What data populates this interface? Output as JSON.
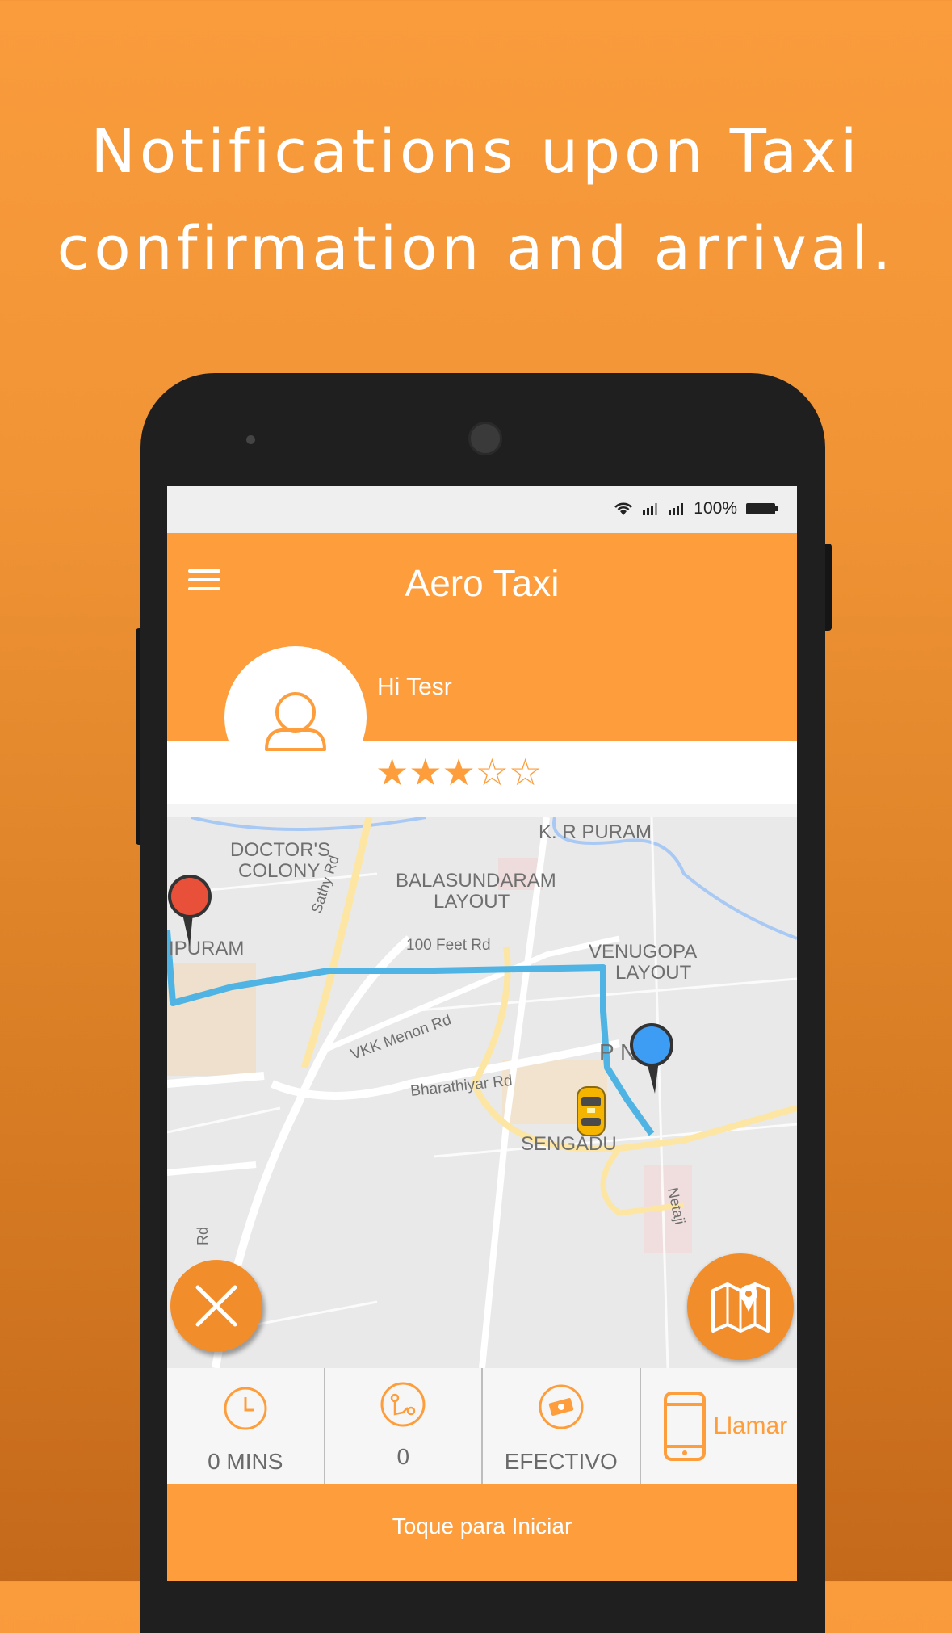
{
  "headline": {
    "line1": "Notifications upon Taxi",
    "line2": "confirmation and arrival."
  },
  "status_bar": {
    "battery": "100%",
    "icons": [
      "wifi-icon",
      "signal-icon",
      "signal-icon",
      "battery-icon"
    ]
  },
  "app_bar": {
    "title": "Aero Taxi",
    "menu_icon": "hamburger-menu-icon"
  },
  "driver": {
    "greeting": "Hi Tesr",
    "avatar_icon": "user-avatar-icon",
    "rating": 3,
    "rating_max": 5
  },
  "map": {
    "labels": {
      "kr_puram": "K. R PURAM",
      "doctors_colony_1": "DOCTOR'S",
      "doctors_colony_2": "COLONY",
      "sathy_rd": "Sathy Rd",
      "balasundaram_1": "BALASUNDARAM",
      "balasundaram_2": "LAYOUT",
      "ipuram": "IPURAM",
      "feet_rd": "100 Feet Rd",
      "venugopa_1": "VENUGOPA",
      "venugopa_2": "LAYOUT",
      "vkk_menon": "VKK Menon Rd",
      "pn": "P N",
      "bharathiyar": "Bharathiyar Rd",
      "sengadu": "SENGADU",
      "netaji": "Netaji",
      "rd_left": "Rd"
    },
    "colors": {
      "route": "#4fb3e3",
      "pickup_pin": "#e8503a",
      "destination_pin": "#3d9cf3"
    }
  },
  "fabs": {
    "cancel_icon": "close-icon",
    "map_icon": "map-pin-icon"
  },
  "trip_info": {
    "time": "0 MINS",
    "distance": "0",
    "payment": "EFECTIVO",
    "call": "Llamar"
  },
  "action": {
    "start": "Toque para Iniciar"
  },
  "colors": {
    "accent": "#fd9d3c",
    "background_top": "#fa9c3c",
    "background_bottom": "#c4691a"
  }
}
